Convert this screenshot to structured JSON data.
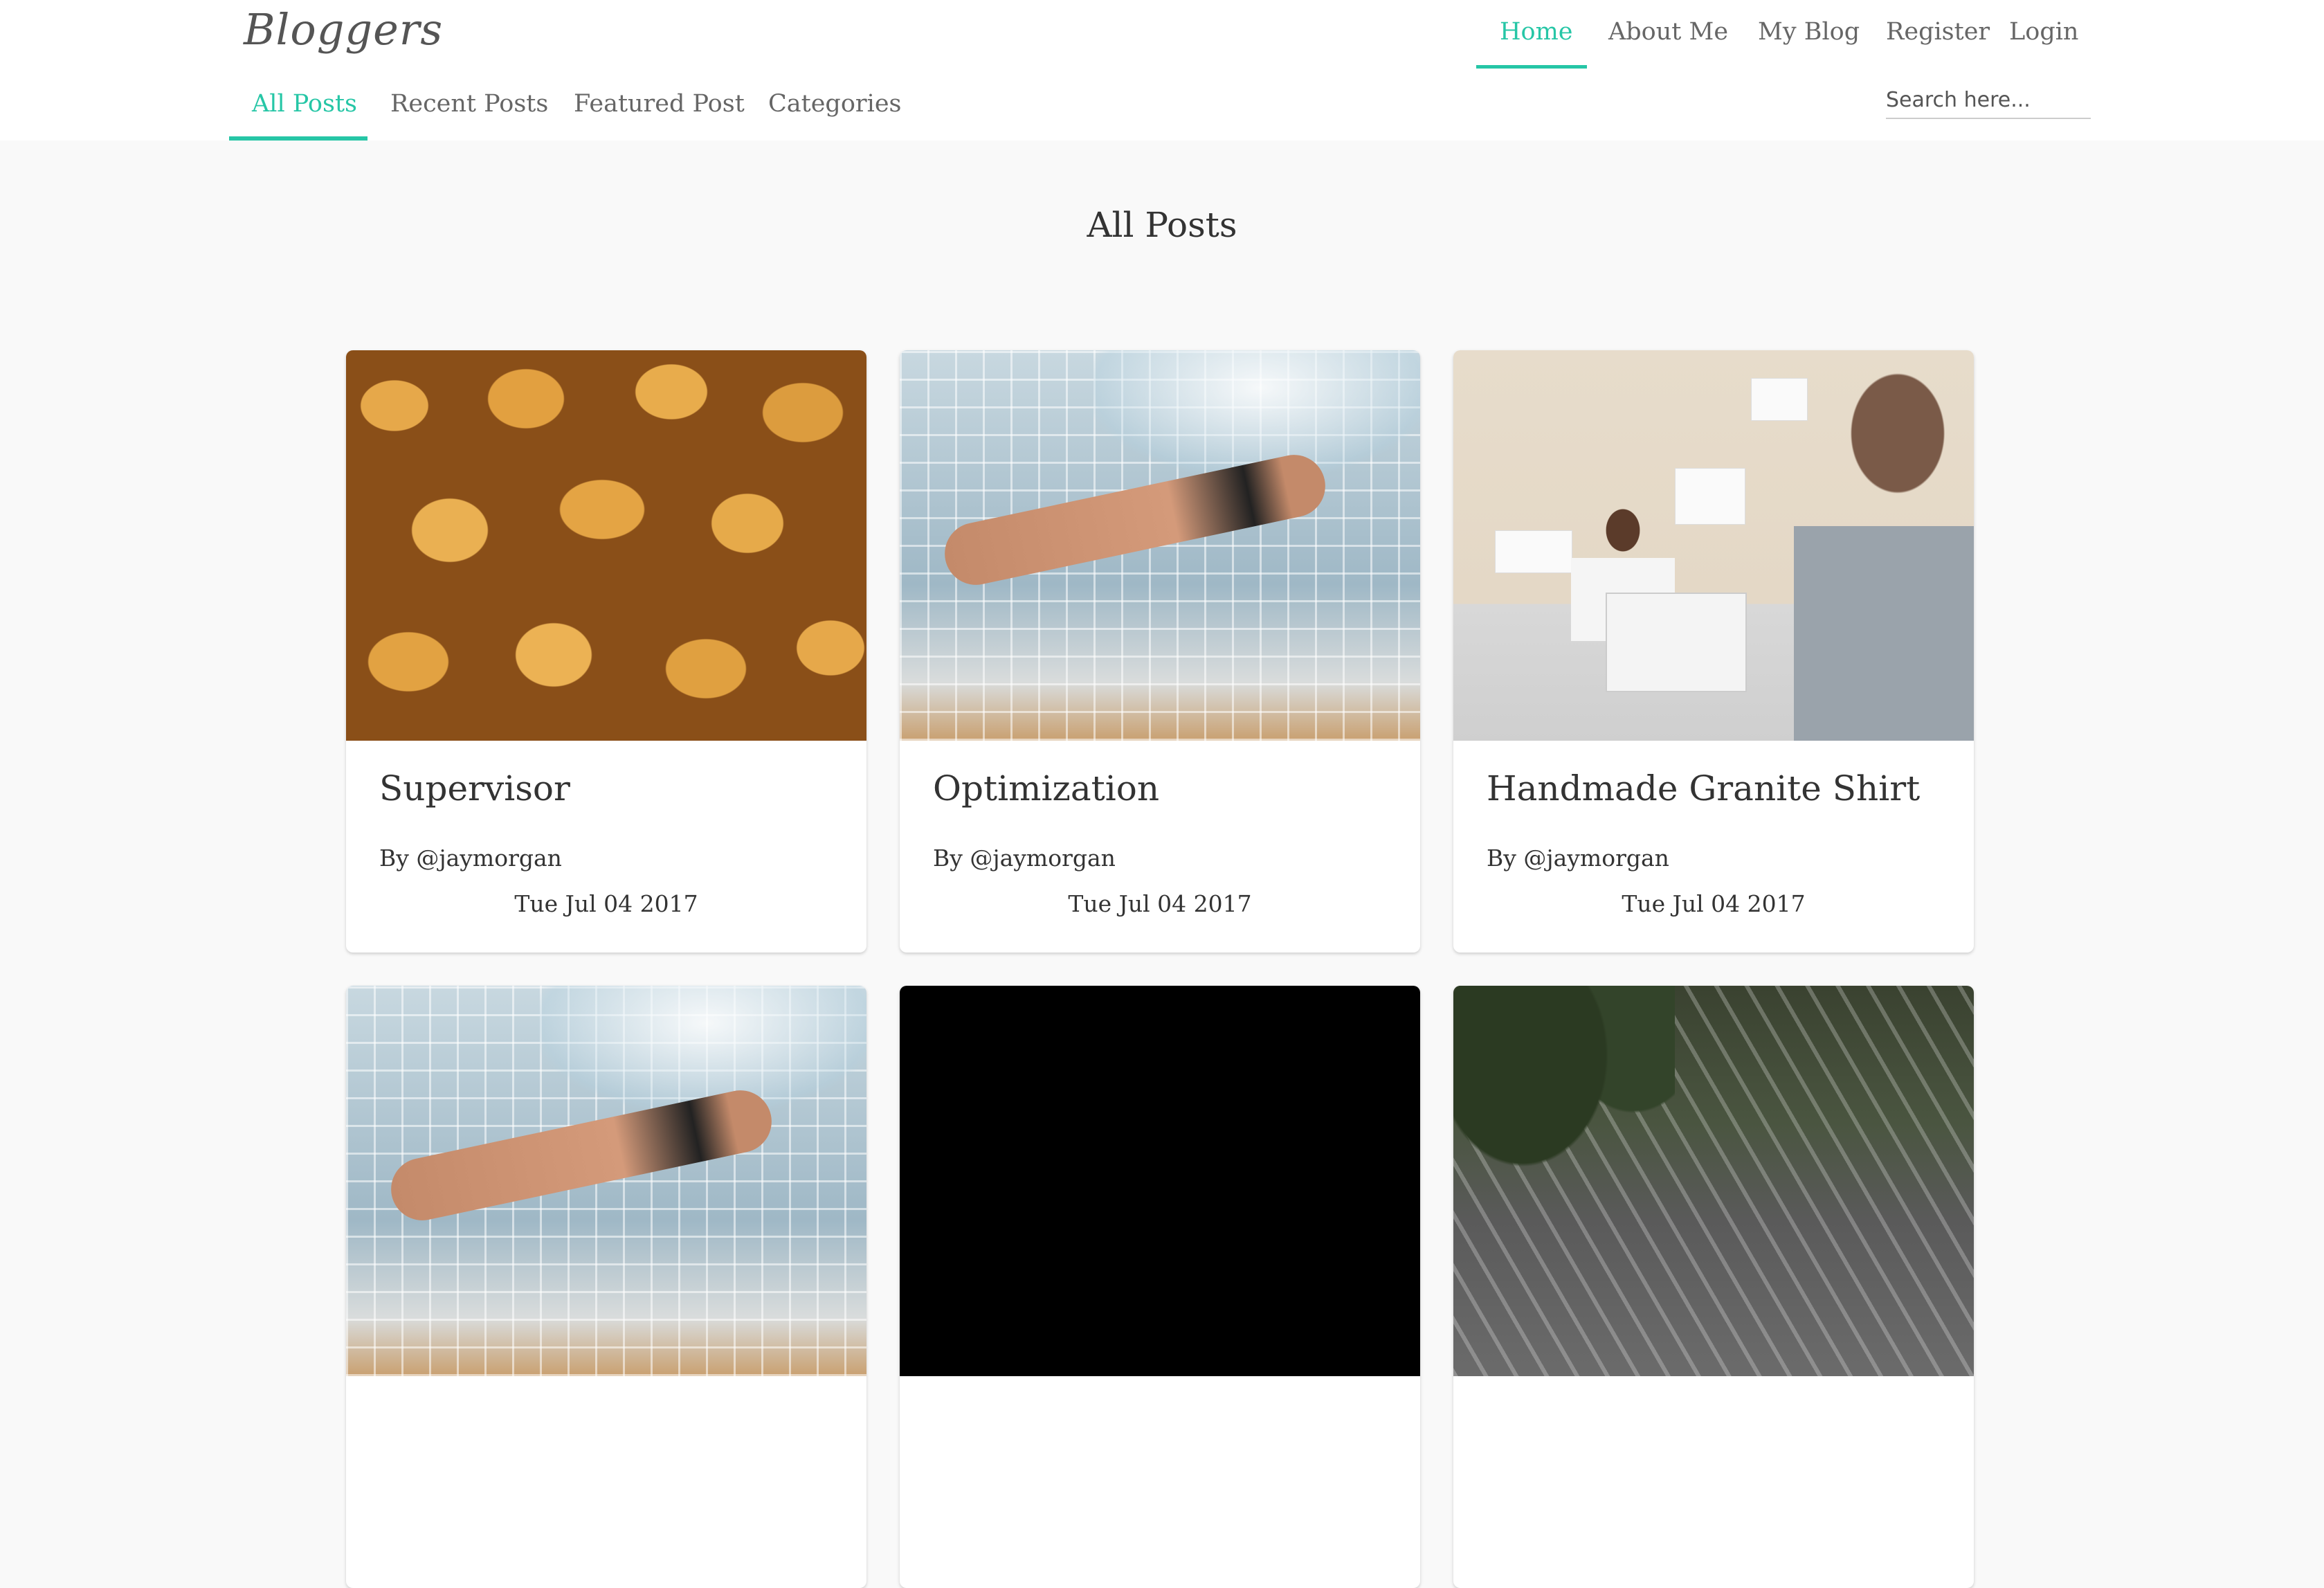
{
  "brand": "Bloggers",
  "main_nav": {
    "items": [
      {
        "label": "Home",
        "active": true
      },
      {
        "label": "About Me",
        "active": false
      },
      {
        "label": "My Blog",
        "active": false
      },
      {
        "label": "Register",
        "active": false
      },
      {
        "label": "Login",
        "active": false
      }
    ]
  },
  "sub_nav": {
    "tabs": [
      {
        "label": "All Posts",
        "active": true
      },
      {
        "label": "Recent Posts",
        "active": false
      },
      {
        "label": "Featured Post",
        "active": false
      },
      {
        "label": "Categories",
        "active": false
      }
    ]
  },
  "search": {
    "placeholder": "Search here..."
  },
  "page": {
    "title": "All Posts"
  },
  "posts": [
    {
      "title": "Supervisor",
      "author": "By @jaymorgan",
      "date": "Tue Jul 04 2017",
      "image": "bread-rolls"
    },
    {
      "title": "Optimization",
      "author": "By @jaymorgan",
      "date": "Tue Jul 04 2017",
      "image": "underwater-swimmer"
    },
    {
      "title": "Handmade Granite Shirt",
      "author": "By @jaymorgan",
      "date": "Tue Jul 04 2017",
      "image": "office-presentation"
    },
    {
      "title": "",
      "author": "",
      "date": "",
      "image": "underwater-swimmer"
    },
    {
      "title": "",
      "author": "",
      "date": "",
      "image": "black"
    },
    {
      "title": "",
      "author": "",
      "date": "",
      "image": "traffic-highway"
    }
  ],
  "colors": {
    "accent": "#26c6a6",
    "background": "#f9f9f9",
    "text": "#333333"
  }
}
